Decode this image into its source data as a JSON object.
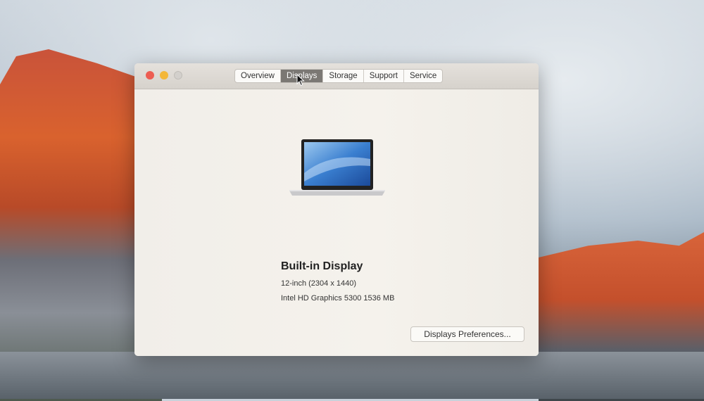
{
  "window": {
    "tabs": [
      {
        "label": "Overview",
        "active": false
      },
      {
        "label": "Displays",
        "active": true
      },
      {
        "label": "Storage",
        "active": false
      },
      {
        "label": "Support",
        "active": false
      },
      {
        "label": "Service",
        "active": false
      }
    ],
    "traffic_lights": {
      "close": "#ed5d52",
      "minimize": "#f3b73a",
      "zoom": "#cfccc8"
    }
  },
  "display": {
    "icon": "laptop-icon",
    "name": "Built-in Display",
    "size_resolution": "12-inch (2304 x 1440)",
    "graphics": "Intel HD Graphics 5300 1536 MB",
    "preferences_button": "Displays Preferences..."
  }
}
